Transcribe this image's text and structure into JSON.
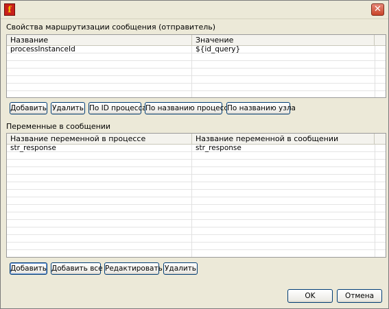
{
  "window": {
    "icon_glyph": "f",
    "close_glyph": "✕"
  },
  "routing": {
    "label": "Свойства маршрутизации сообщения (отправитель)",
    "columns": [
      "Название",
      "Значение"
    ],
    "rows": [
      {
        "name": "processInstanceId",
        "value": "${id_query}"
      }
    ],
    "buttons": {
      "add": "Добавить",
      "delete": "Удалить",
      "by_process_id": "По ID процесса",
      "by_process_name": "По названию процесса",
      "by_node_name": "По названию узла"
    }
  },
  "variables": {
    "label": "Переменные в сообщении",
    "columns": [
      "Название переменной в процессе",
      "Название переменной в сообщении"
    ],
    "rows": [
      {
        "process_var": "str_response",
        "message_var": "str_response"
      }
    ],
    "buttons": {
      "add": "Добавить",
      "add_all": "Добавить все",
      "edit": "Редактировать",
      "delete": "Удалить"
    }
  },
  "footer": {
    "ok": "OK",
    "cancel": "Отмена"
  }
}
